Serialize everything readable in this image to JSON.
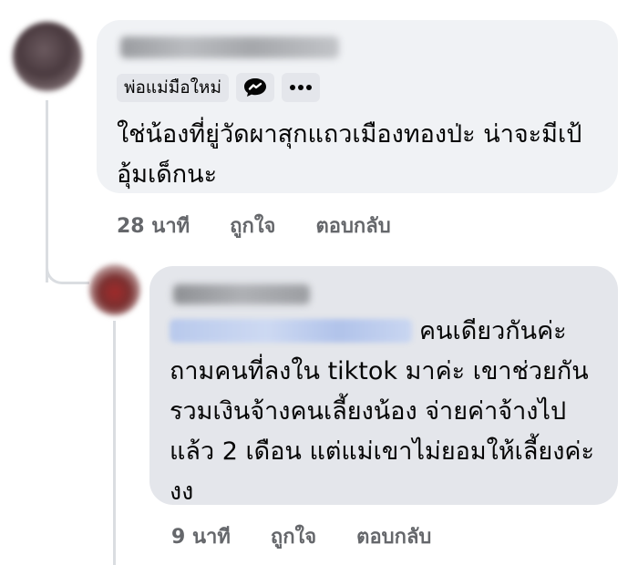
{
  "comments": [
    {
      "group_badge": "พ่อแม่มือใหม่",
      "icons": [
        "message-badge-icon",
        "more-options-icon"
      ],
      "text": "ใช่น้องที่ยู่วัดผาสุกแถวเมืองทองป่ะ น่าจะมีเป้อุ้มเด็กนะ",
      "time": "28 นาที",
      "like_label": "ถูกใจ",
      "reply_label": "ตอบกลับ"
    },
    {
      "text": "คนเดียวกันค่ะ ถามคนที่ลงใน tiktok มาค่ะ เขาช่วยกันรวมเงินจ้างคนเลี้ยงน้อง จ่ายค่าจ้างไปแล้ว 2 เดือน แต่แม่เขาไม่ยอมให้เลี้ยงค่ะ งง",
      "time": "9 นาที",
      "like_label": "ถูกใจ",
      "reply_label": "ตอบกลับ"
    }
  ],
  "colors": {
    "bubble": "#f0f2f5",
    "reply_bubble": "#e4e6eb",
    "action_text": "#65676b",
    "thread_line": "#dadde1"
  }
}
